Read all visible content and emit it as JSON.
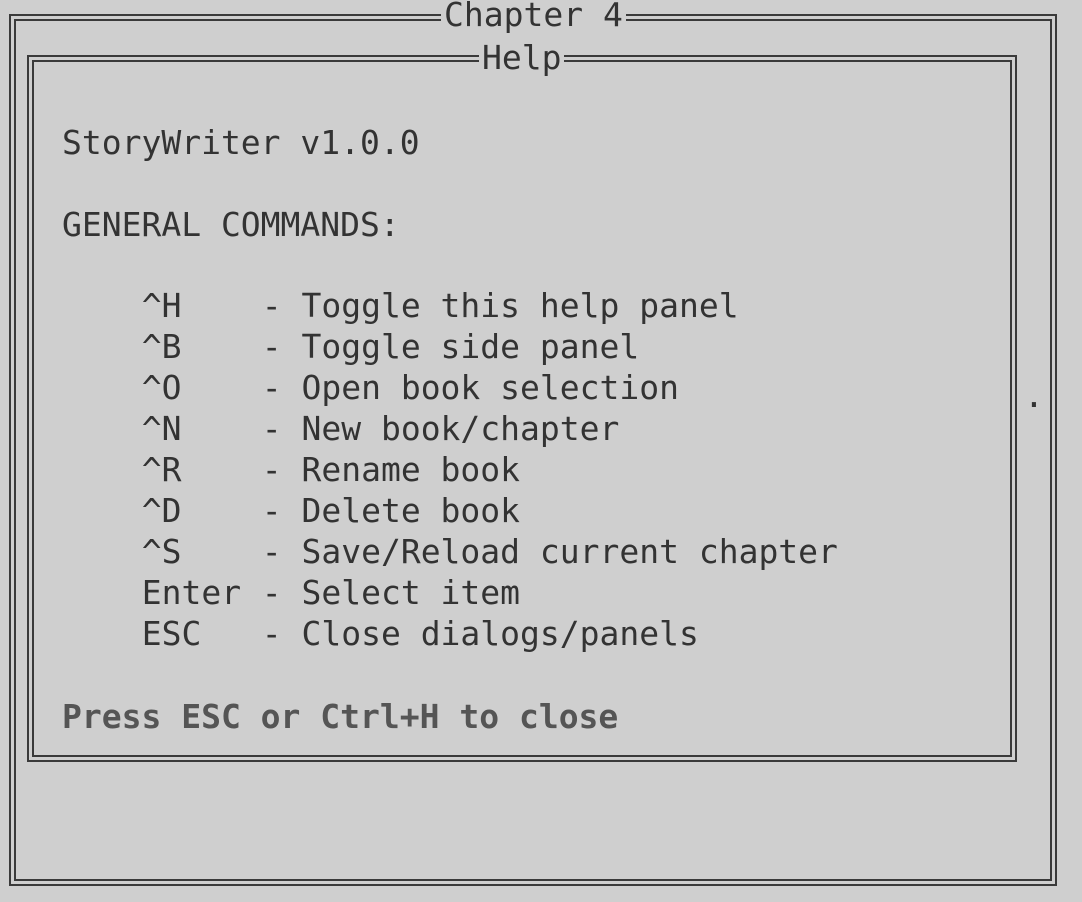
{
  "window": {
    "chapter_title": "Chapter 4"
  },
  "help_panel": {
    "title": "Help",
    "app_version": "StoryWriter v1.0.0",
    "section_heading": "GENERAL COMMANDS:",
    "commands": [
      {
        "key": "^H",
        "desc": "- Toggle this help panel"
      },
      {
        "key": "^B",
        "desc": "- Toggle side panel"
      },
      {
        "key": "^O",
        "desc": "- Open book selection"
      },
      {
        "key": "^N",
        "desc": "- New book/chapter"
      },
      {
        "key": "^R",
        "desc": "- Rename book"
      },
      {
        "key": "^D",
        "desc": "- Delete book"
      },
      {
        "key": "^S",
        "desc": "- Save/Reload current chapter"
      },
      {
        "key": "Enter",
        "desc": "- Select item"
      },
      {
        "key": "ESC",
        "desc": "- Close dialogs/panels"
      }
    ],
    "footer": "Press ESC or Ctrl+H to close"
  },
  "side_marker": "."
}
